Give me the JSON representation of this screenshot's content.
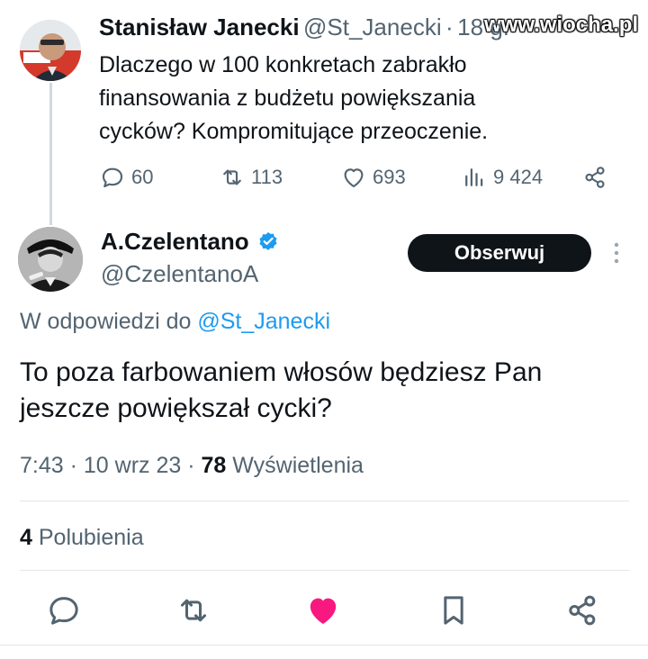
{
  "watermark": "www.wiocha.pl",
  "parent_tweet": {
    "author_name": "Stanisław Janecki",
    "author_handle": "@St_Janecki",
    "time_sep": "·",
    "time_ago": "18 g.",
    "text_lines": [
      "Dlaczego w 100 konkretach zabrakło",
      "finansowania z budżetu powiększania",
      "cycków? Kompromitujące przeoczenie."
    ],
    "stats": {
      "replies": "60",
      "retweets": "113",
      "likes": "693",
      "views": "9 424"
    }
  },
  "reply_tweet": {
    "author_name": "A.Czelentano",
    "author_handle": "@CzelentanoA",
    "verified": true,
    "follow_label": "Obserwuj",
    "reply_to_prefix": "W odpowiedzi do",
    "reply_to_handle": "@St_Janecki",
    "text_lines": [
      "To poza farbowaniem włosów będziesz Pan",
      "jeszcze powiększał cycki?"
    ],
    "meta": {
      "time": "7:43",
      "date": "10 wrz 23",
      "sep": "·",
      "views_count": "78",
      "views_label": "Wyświetlenia"
    },
    "likes_count": "4",
    "likes_label": "Polubienia",
    "liked": true
  },
  "colors": {
    "text": "#0f1419",
    "muted": "#536471",
    "link": "#1d9bf0",
    "like_active": "#f91880",
    "verified": "#1d9bf0",
    "button_bg": "#0f1419"
  },
  "icons": [
    "reply-icon",
    "retweet-icon",
    "like-icon",
    "views-icon",
    "share-icon",
    "verified-icon",
    "more-icon",
    "bookmark-icon"
  ]
}
